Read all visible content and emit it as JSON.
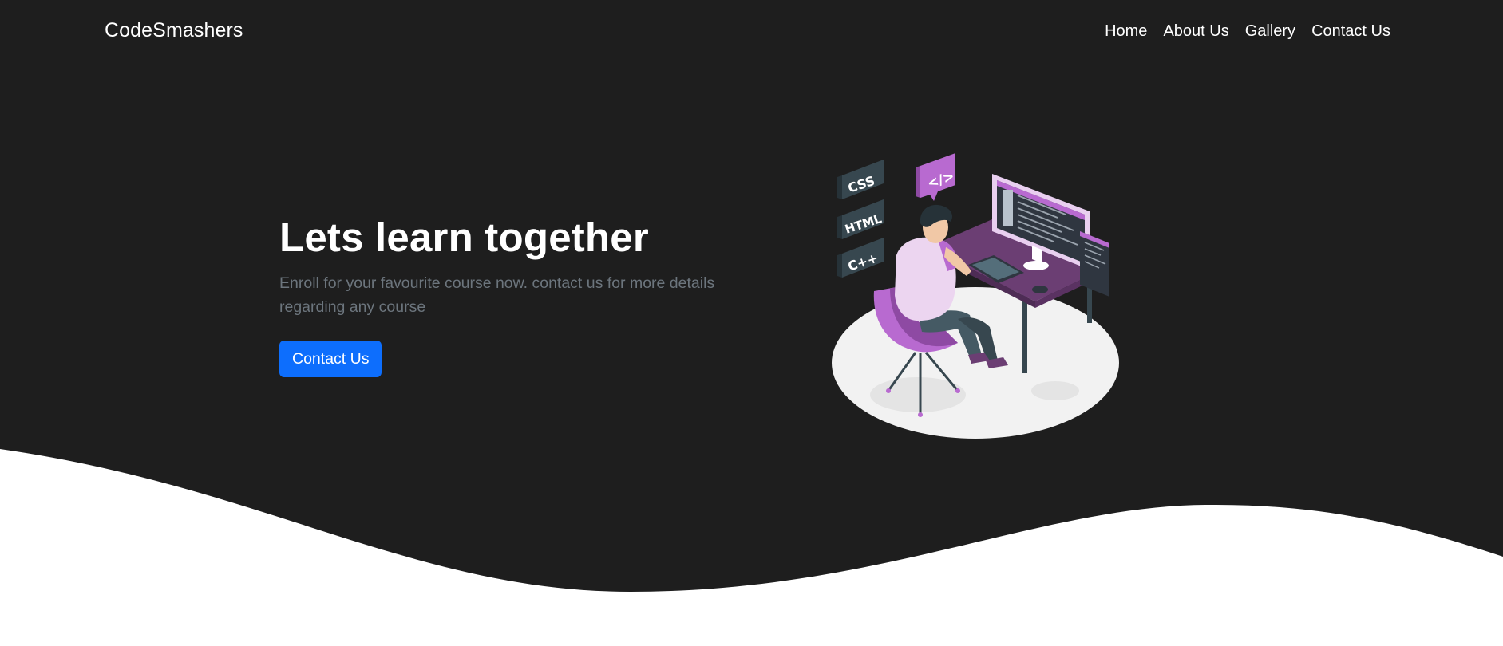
{
  "navbar": {
    "brand": "CodeSmashers",
    "links": [
      {
        "label": "Home"
      },
      {
        "label": "About Us"
      },
      {
        "label": "Gallery"
      },
      {
        "label": "Contact Us"
      }
    ]
  },
  "hero": {
    "title": "Lets learn together",
    "subtitle": "Enroll for your favourite course now. contact us for more details regarding any course",
    "cta_label": "Contact Us"
  },
  "illustration": {
    "tags": [
      "CSS",
      "HTML",
      "C++"
    ],
    "code_bubble": "</>"
  },
  "colors": {
    "background_dark": "#1e1e1e",
    "accent_blue": "#0d6efd",
    "accent_purple": "#b86ad0",
    "muted_text": "#6c757d"
  }
}
